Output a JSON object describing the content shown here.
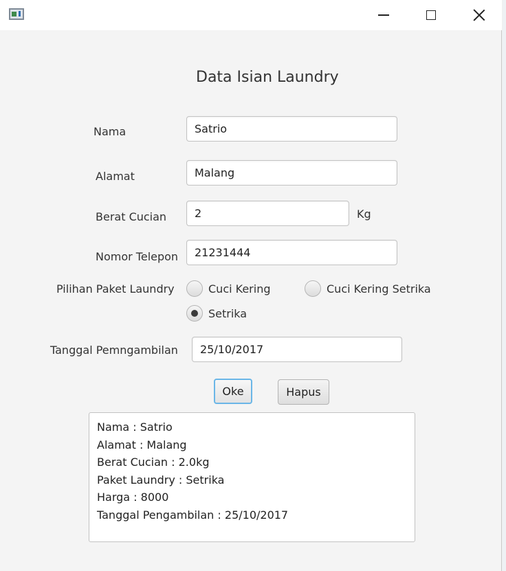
{
  "window": {
    "app_icon": "java-app-icon",
    "controls": {
      "minimize": "minimize-icon",
      "maximize": "maximize-icon",
      "close": "close-icon"
    }
  },
  "form": {
    "title": "Data Isian Laundry",
    "nama": {
      "label": "Nama",
      "value": "Satrio"
    },
    "alamat": {
      "label": "Alamat",
      "value": "Malang"
    },
    "berat": {
      "label": "Berat Cucian",
      "value": "2",
      "unit": "Kg"
    },
    "telepon": {
      "label": "Nomor Telepon",
      "value": "21231444"
    },
    "paket": {
      "label": "Pilihan Paket Laundry",
      "options": [
        {
          "label": "Cuci Kering",
          "checked": false
        },
        {
          "label": "Cuci Kering Setrika",
          "checked": false
        },
        {
          "label": "Setrika",
          "checked": true
        }
      ]
    },
    "tanggal": {
      "label": "Tanggal Pemngambilan",
      "value": "25/10/2017"
    },
    "buttons": {
      "oke": "Oke",
      "hapus": "Hapus"
    }
  },
  "output": {
    "lines": [
      "Nama : Satrio",
      "Alamat : Malang",
      "Berat Cucian : 2.0kg",
      "Paket Laundry : Setrika",
      "Harga : 8000",
      "Tanggal Pengambilan : 25/10/2017"
    ]
  },
  "colors": {
    "focus_ring": "#6ab6e7",
    "window_bg": "#f4f4f4"
  }
}
